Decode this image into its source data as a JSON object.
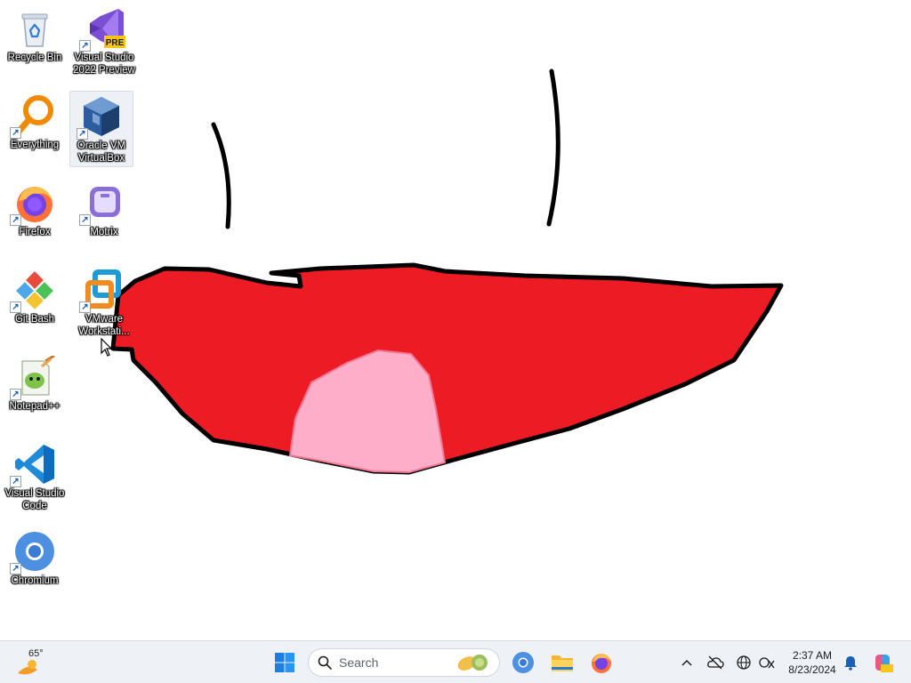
{
  "desktop": {
    "icons": [
      {
        "label": "Recycle Bin",
        "icon": "recycle-bin-icon"
      },
      {
        "label": "Visual Studio 2022 Preview",
        "icon": "visual-studio-preview-icon",
        "badge": "PRE"
      },
      {
        "label": "Everything",
        "icon": "everything-search-icon"
      },
      {
        "label": "Oracle VM VirtualBox",
        "icon": "virtualbox-icon"
      },
      {
        "label": "Firefox",
        "icon": "firefox-icon"
      },
      {
        "label": "Motrix",
        "icon": "motrix-icon"
      },
      {
        "label": "Git Bash",
        "icon": "git-bash-icon"
      },
      {
        "label": "VMware Workstati...",
        "icon": "vmware-icon"
      },
      {
        "label": "Notepad++",
        "icon": "notepad-plus-plus-icon"
      },
      {
        "label": "Visual Studio Code",
        "icon": "vscode-icon"
      },
      {
        "label": "Chromium",
        "icon": "chromium-icon"
      }
    ]
  },
  "wallpaper": {
    "colors": {
      "fill": "#ed1c24",
      "tongue": "#ffaec9",
      "outline": "#000000"
    }
  },
  "taskbar": {
    "weather": {
      "temp": "65°",
      "icon": "weather-sun-icon"
    },
    "start_icon": "windows-start-icon",
    "search": {
      "placeholder": "Search"
    },
    "pinned": [
      "chromium-icon",
      "file-explorer-icon",
      "firefox-icon"
    ],
    "tray": {
      "time": "2:37 AM",
      "date": "8/23/2024",
      "icons": [
        "chevron-up-icon",
        "cloud-offline-icon",
        "globe-network-icon",
        "accessibility-icon",
        "notification-bell-icon",
        "copilot-icon"
      ]
    }
  }
}
